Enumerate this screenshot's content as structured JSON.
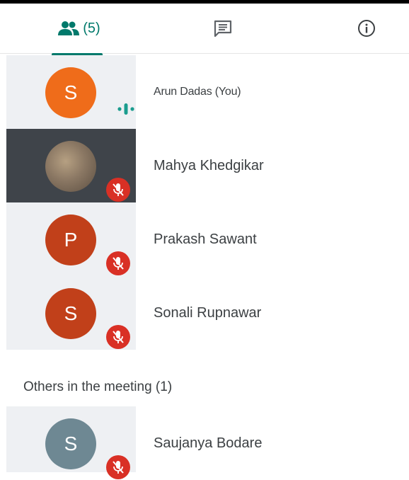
{
  "tabs": {
    "people_count": "(5)",
    "people_icon": "people-icon",
    "chat_icon": "chat-icon",
    "info_icon": "info-icon"
  },
  "participants": [
    {
      "initial": "S",
      "name": "Arun Dadas (You)",
      "status": "speaking",
      "avatar_color": "#ef6c1a"
    },
    {
      "initial": "",
      "name": "Mahya Khedgikar",
      "status": "muted",
      "avatar_color": "photo"
    },
    {
      "initial": "P",
      "name": "Prakash Sawant",
      "status": "muted",
      "avatar_color": "#c1401a"
    },
    {
      "initial": "S",
      "name": "Sonali Rupnawar",
      "status": "muted",
      "avatar_color": "#c1401a"
    }
  ],
  "others": {
    "label": "Others in the meeting (1)",
    "participants": [
      {
        "initial": "S",
        "name": "Saujanya Bodare",
        "status": "muted",
        "avatar_color": "#6e8893"
      }
    ]
  },
  "colors": {
    "accent": "#00796b",
    "muted_badge": "#d93025",
    "tile_background": "#eef0f3"
  }
}
